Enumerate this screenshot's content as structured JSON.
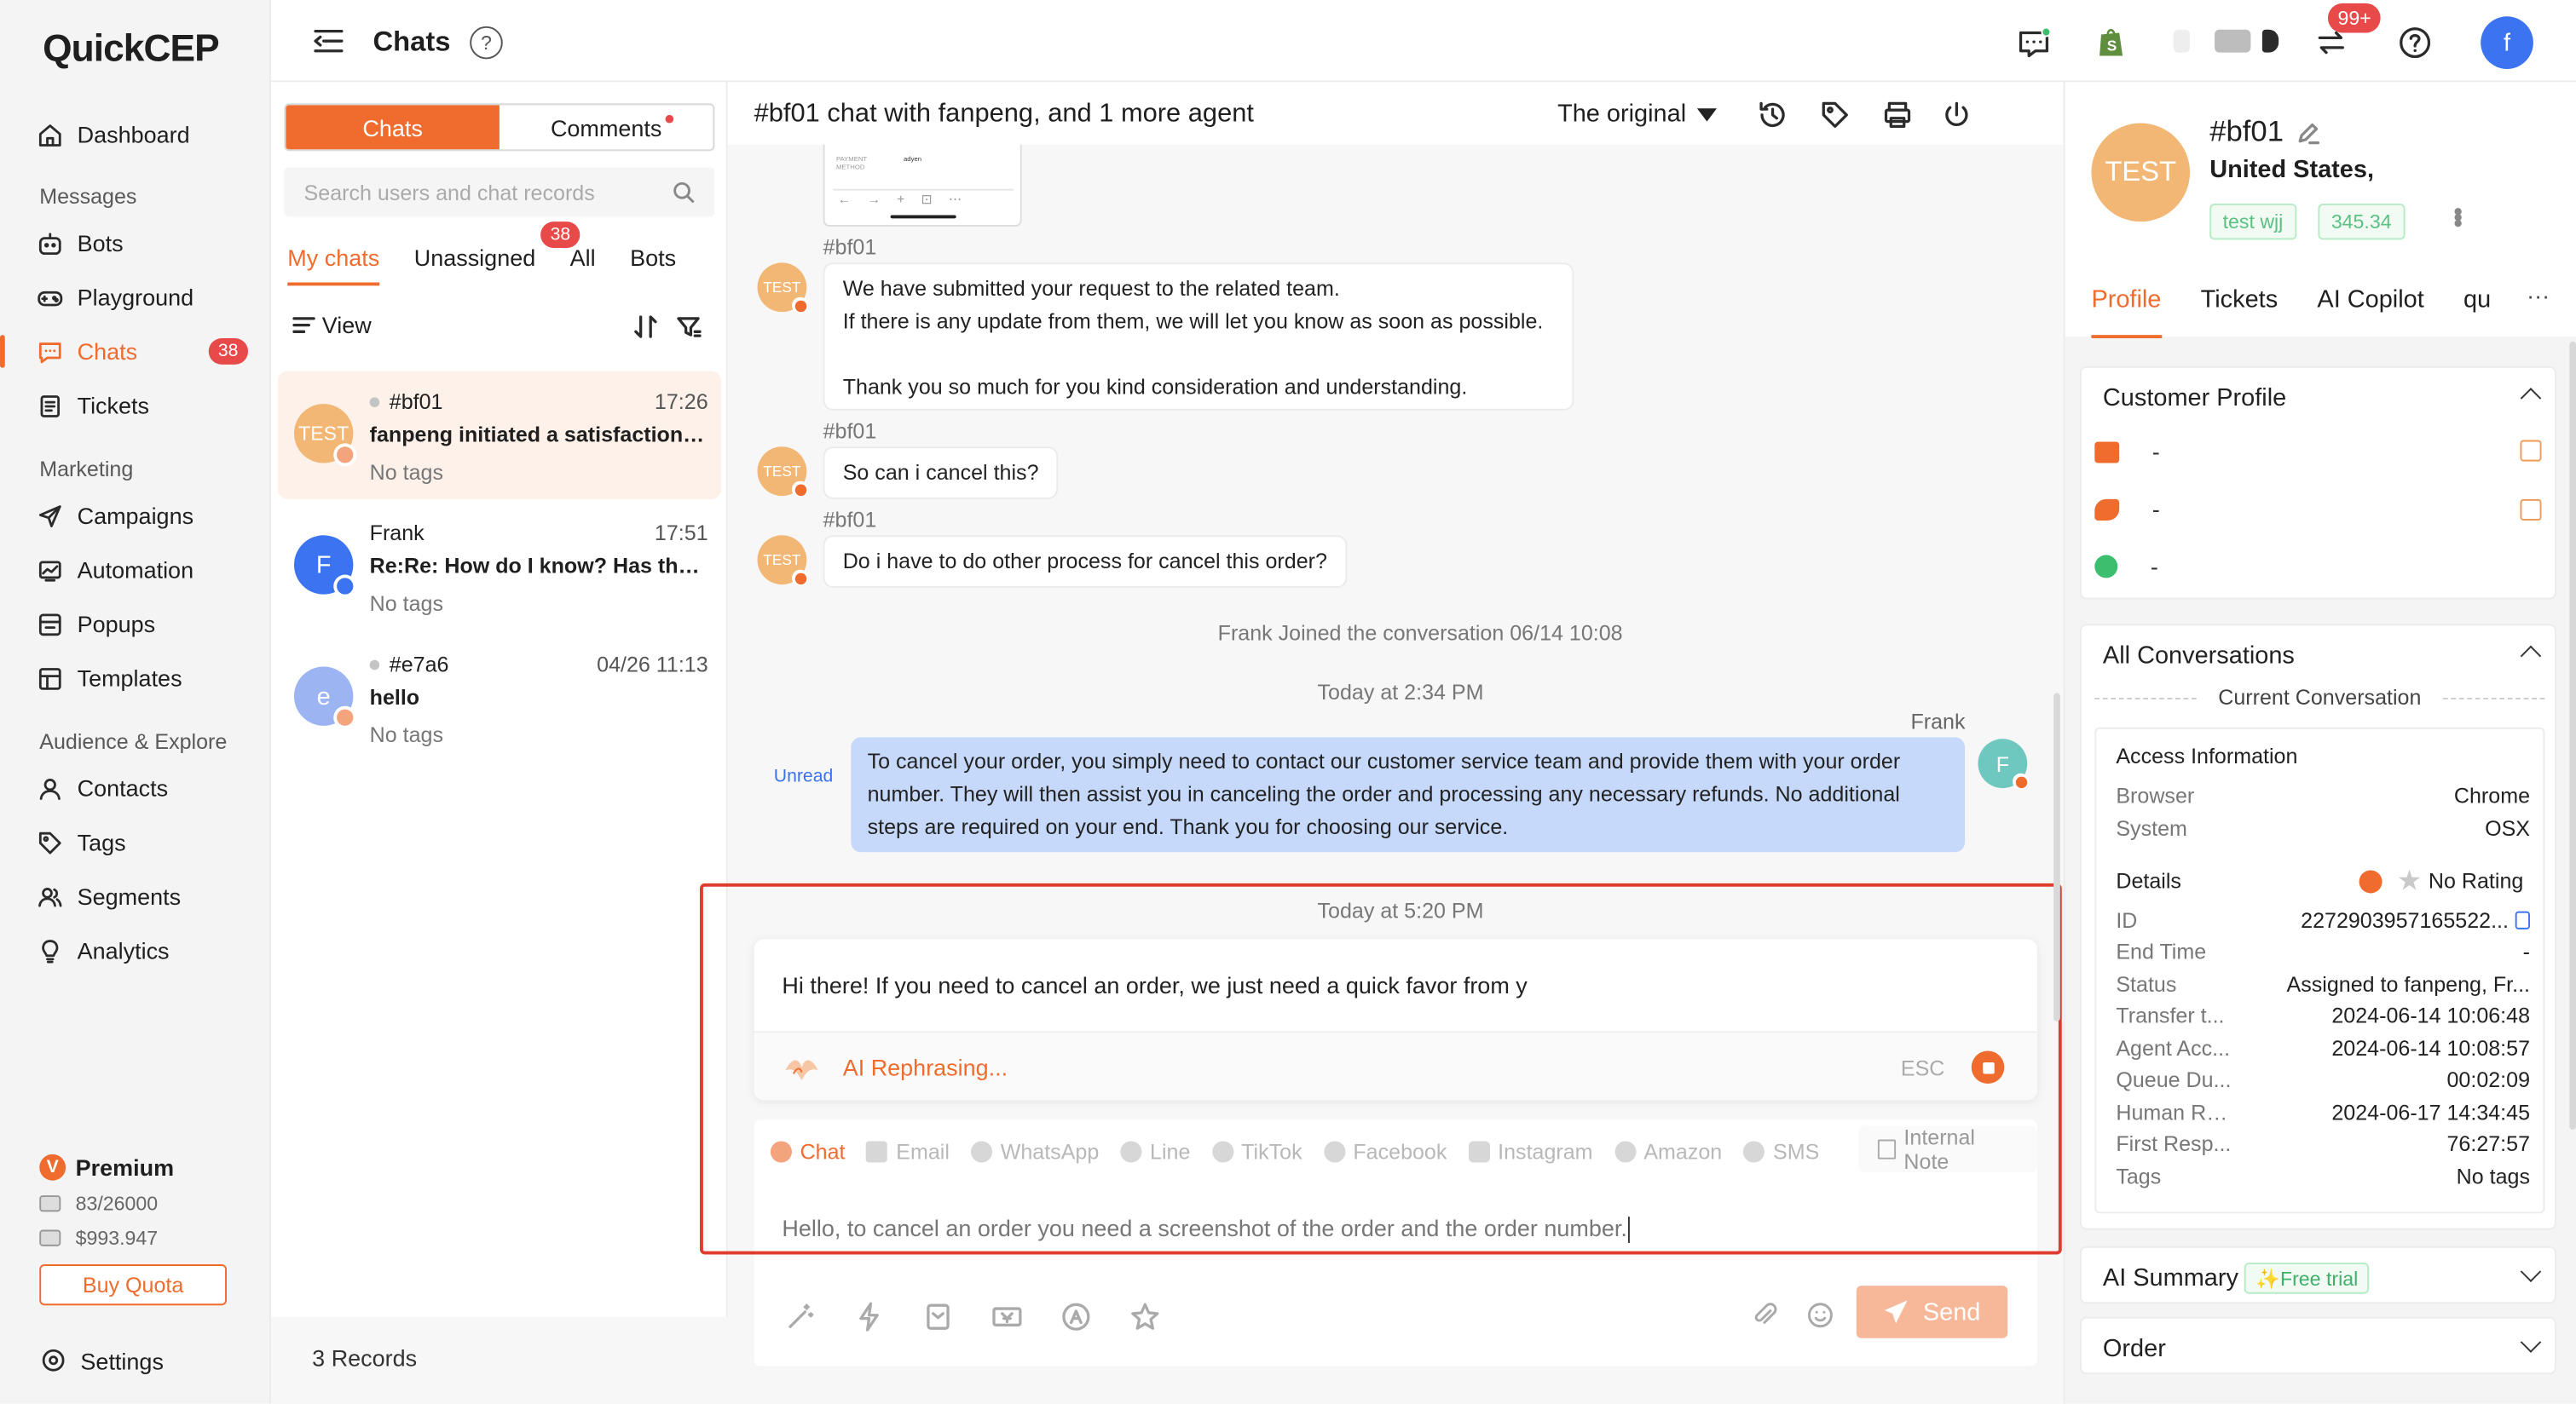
{
  "app": {
    "logo": "QuickCEP"
  },
  "colors": {
    "accent": "#ef6c2e",
    "badge": "#e84a4a",
    "agent_bubble": "#c6d9fa",
    "highlight_frame": "#e03b2f"
  },
  "nav": {
    "dashboard": "Dashboard",
    "section_messages": "Messages",
    "bots": "Bots",
    "playground": "Playground",
    "chats": "Chats",
    "chats_badge": "38",
    "tickets": "Tickets",
    "section_marketing": "Marketing",
    "campaigns": "Campaigns",
    "automation": "Automation",
    "popups": "Popups",
    "templates": "Templates",
    "section_audience": "Audience & Explore",
    "contacts": "Contacts",
    "tags": "Tags",
    "segments": "Segments",
    "analytics": "Analytics",
    "plan_icon": "V",
    "plan": "Premium",
    "quota_messages": "83/26000",
    "quota_money": "$993.947",
    "buy_quota": "Buy Quota",
    "settings": "Settings"
  },
  "topbar": {
    "title": "Chats",
    "help_icon": "?",
    "notif_badge": "99+",
    "avatar_letter": "f"
  },
  "list": {
    "tab_chats": "Chats",
    "tab_comments": "Comments",
    "search_placeholder": "Search users and chat records",
    "subtab_my": "My chats",
    "subtab_unassigned": "Unassigned",
    "unassigned_badge": "38",
    "subtab_all": "All",
    "subtab_bots": "Bots",
    "view": "View",
    "items": [
      {
        "avatar": "TEST",
        "name": "#bf01",
        "time": "17:26",
        "message": "fanpeng initiated a satisfaction r...",
        "tags": "No tags"
      },
      {
        "avatar": "F",
        "name": "Frank",
        "time": "17:51",
        "message": "Re:Re: How do I know? Has the ...",
        "tags": "No tags"
      },
      {
        "avatar": "e",
        "name": "#e7a6",
        "time": "04/26 11:13",
        "message": "hello",
        "tags": "No tags"
      }
    ],
    "records": "3 Records"
  },
  "conversation": {
    "title": "#bf01 chat with fanpeng, and 1 more agent",
    "language_dropdown": "The original",
    "thumb_text_1": "PAYMENT METHOD",
    "thumb_text_2": "adyen",
    "messages": [
      {
        "sender": "#bf01",
        "avatar": "TEST",
        "lines": [
          "We have submitted your request to the related team.",
          "If there is any update from them, we will let you know as soon as possible.",
          "",
          "Thank you so much for you kind consideration and understanding."
        ]
      },
      {
        "sender": "#bf01",
        "avatar": "TEST",
        "lines": [
          "So can i cancel this?"
        ]
      },
      {
        "sender": "#bf01",
        "avatar": "TEST",
        "lines": [
          "Do i have to do other process for cancel this order?"
        ]
      }
    ],
    "joined": "Frank Joined the conversation   06/14 10:08",
    "today_1": "Today at 2:34 PM",
    "agent_name": "Frank",
    "agent_avatar": "F",
    "unread": "Unread",
    "agent_message": "To cancel your order, you simply need to contact our customer service team and provide them with your order number. They will then assist you in canceling the order and processing any necessary refunds. No additional steps are required on your end. Thank you for choosing our service.",
    "today_2": "Today at 5:20 PM"
  },
  "composer": {
    "rephrase_text": "Hi there! If you need to cancel an order, we just need a quick favor from y",
    "ai_label": "AI Rephrasing...",
    "esc": "ESC",
    "channels": [
      "Chat",
      "Email",
      "WhatsApp",
      "Line",
      "TikTok",
      "Facebook",
      "Instagram",
      "Amazon",
      "SMS"
    ],
    "internal_note": "Internal Note",
    "draft": "Hello, to cancel an order you need a screenshot of the order and the order number.",
    "send": "Send"
  },
  "profile": {
    "avatar": "TEST",
    "name": "#bf01",
    "location": "United States,",
    "tag_1": "test wjj",
    "tag_2": "345.34",
    "tabs": [
      "Profile",
      "Tickets",
      "AI Copilot",
      "qu"
    ],
    "more_tabs": "···",
    "customer_profile": "Customer Profile",
    "email": "-",
    "phone": "-",
    "whatsapp": "-",
    "all_conversations": "All Conversations",
    "current_conversation": "Current Conversation",
    "access_information": "Access Information",
    "browser_label": "Browser",
    "browser": "Chrome",
    "system_label": "System",
    "system": "OSX",
    "details": "Details",
    "rating": "No Rating",
    "rows": [
      {
        "k": "ID",
        "v": "2272903957165522..."
      },
      {
        "k": "End Time",
        "v": "-"
      },
      {
        "k": "Status",
        "v": "Assigned to fanpeng, Fr..."
      },
      {
        "k": "Transfer t...",
        "v": "2024-06-14 10:06:48"
      },
      {
        "k": "Agent Acc...",
        "v": "2024-06-14 10:08:57"
      },
      {
        "k": "Queue Du...",
        "v": "00:02:09"
      },
      {
        "k": "Human Re...",
        "v": "2024-06-17 14:34:45"
      },
      {
        "k": "First Resp...",
        "v": "76:27:57"
      },
      {
        "k": "Tags",
        "v": "No tags"
      }
    ],
    "ai_summary": "AI Summary",
    "free_trial": "✨Free trial",
    "order": "Order"
  }
}
